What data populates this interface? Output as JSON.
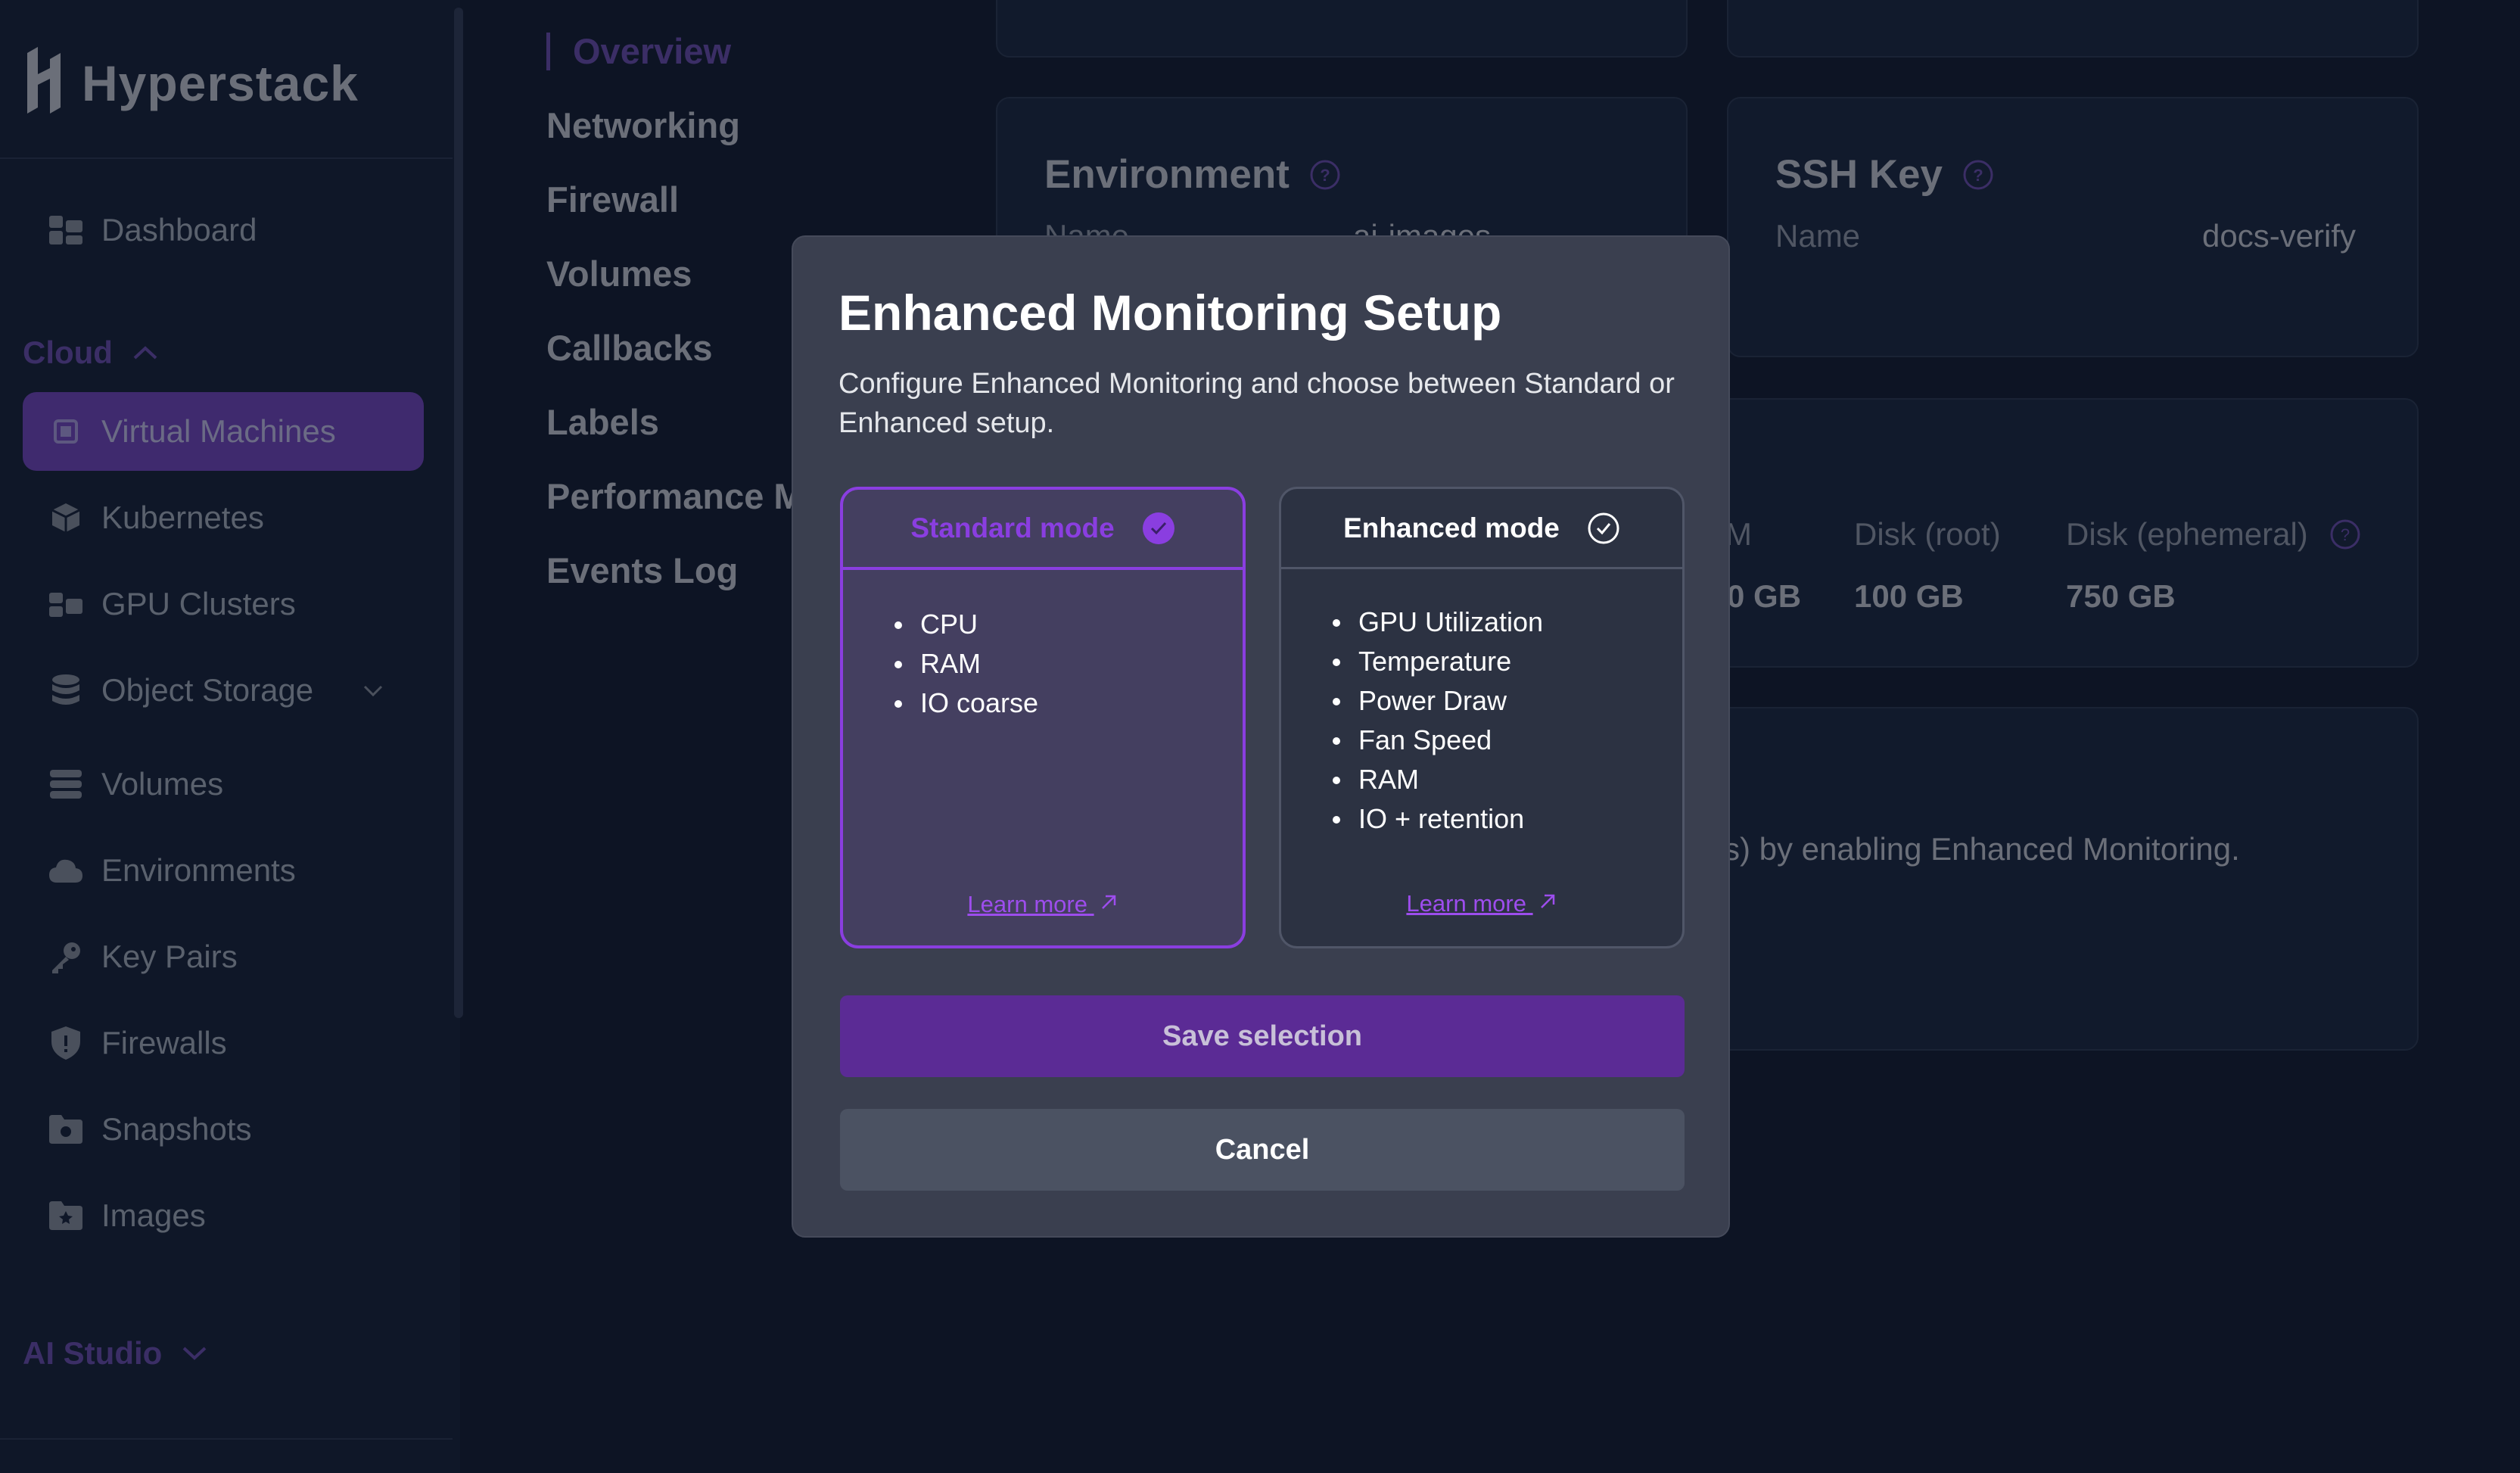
{
  "sidebar": {
    "logo_text": "Hyperstack",
    "items": [
      {
        "label": "Dashboard",
        "icon": "dashboard-icon"
      },
      {
        "label": "Virtual Machines",
        "icon": "chip-icon"
      },
      {
        "label": "Kubernetes",
        "icon": "cube-icon"
      },
      {
        "label": "GPU Clusters",
        "icon": "cluster-icon"
      },
      {
        "label": "Object Storage",
        "icon": "database-icon"
      },
      {
        "label": "Volumes",
        "icon": "stack-icon"
      },
      {
        "label": "Environments",
        "icon": "cloud-icon"
      },
      {
        "label": "Key Pairs",
        "icon": "key-icon"
      },
      {
        "label": "Firewalls",
        "icon": "shield-icon"
      },
      {
        "label": "Snapshots",
        "icon": "folder-icon"
      },
      {
        "label": "Images",
        "icon": "image-folder-icon"
      }
    ],
    "sections": {
      "cloud": "Cloud",
      "ai_studio": "AI Studio"
    },
    "active_item": "Virtual Machines"
  },
  "subnav": {
    "items": [
      "Overview",
      "Networking",
      "Firewall",
      "Volumes",
      "Callbacks",
      "Labels",
      "Performance M",
      "Events Log"
    ],
    "active": "Overview"
  },
  "cards": {
    "environment": {
      "title": "Environment",
      "name_label": "Name",
      "name_value": "ai-images"
    },
    "ssh_key": {
      "title": "SSH Key",
      "name_label": "Name",
      "name_value": "docs-verify"
    },
    "specs": {
      "ram_label": "M",
      "ram_value": "0 GB",
      "disk_root_label": "Disk (root)",
      "disk_root_value": "100 GB",
      "disk_eph_label": "Disk (ephemeral)",
      "disk_eph_value": "750 GB"
    },
    "monitoring_text": "s) by enabling Enhanced Monitoring."
  },
  "modal": {
    "title": "Enhanced Monitoring Setup",
    "description": "Configure Enhanced Monitoring and choose between Standard or Enhanced setup.",
    "standard": {
      "label": "Standard mode",
      "selected": true,
      "items": [
        "CPU",
        "RAM",
        "IO coarse"
      ],
      "learn_more": "Learn more"
    },
    "enhanced": {
      "label": "Enhanced mode",
      "selected": false,
      "items": [
        "GPU Utilization",
        "Temperature",
        "Power Draw",
        "Fan Speed",
        "RAM",
        "IO + retention"
      ],
      "learn_more": "Learn more"
    },
    "save_label": "Save selection",
    "cancel_label": "Cancel"
  },
  "colors": {
    "accent": "#8a3ee0",
    "save_button": "#5b2b95",
    "modal_bg": "#3a3f4f",
    "page_bg": "#0d1424"
  }
}
